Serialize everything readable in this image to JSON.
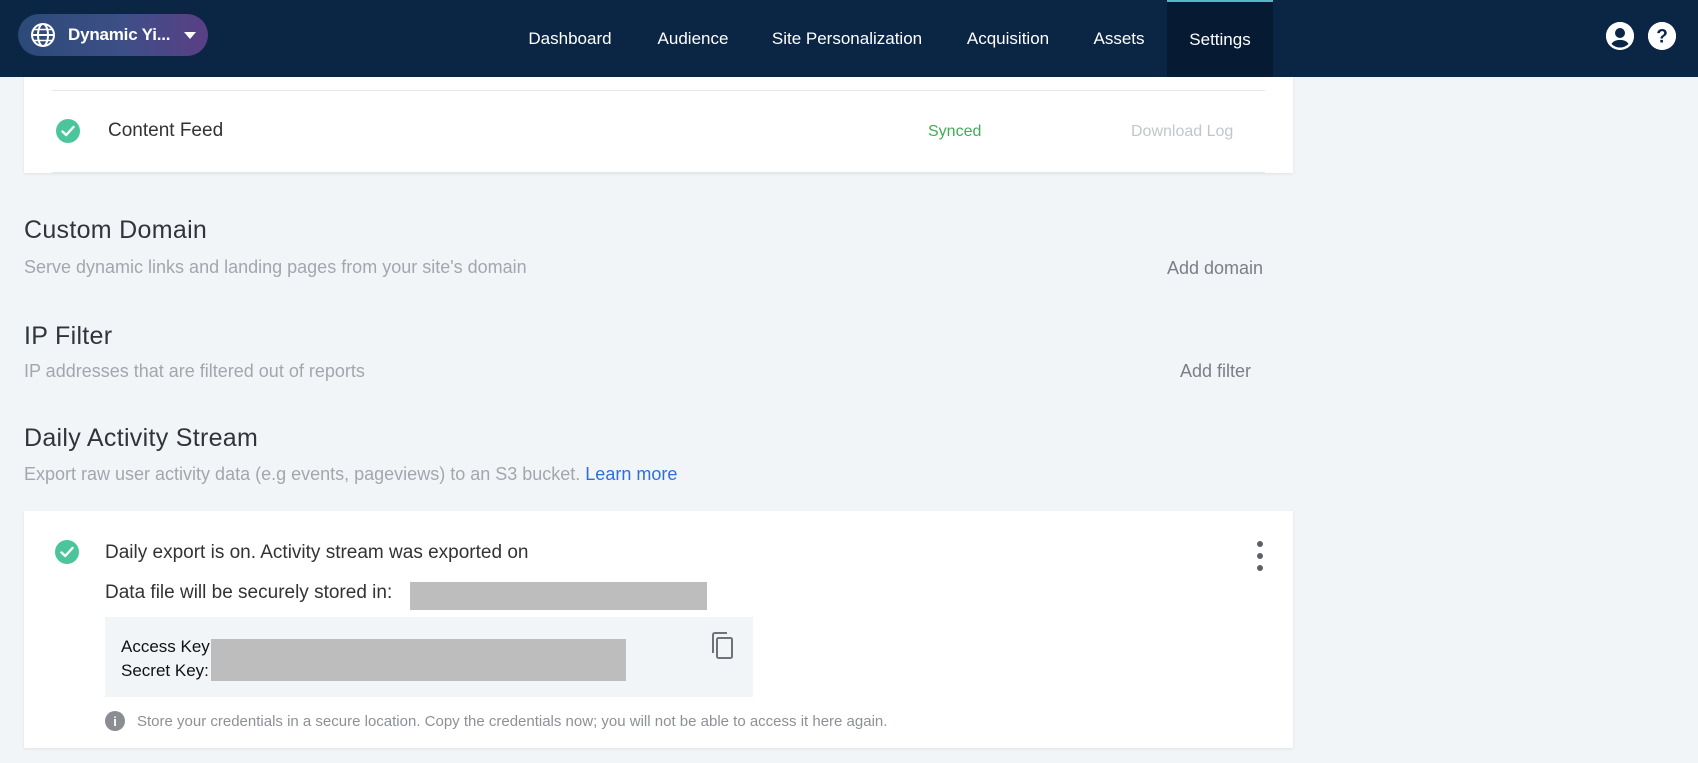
{
  "header": {
    "site_name": "Dynamic Yi...",
    "nav": [
      {
        "label": "Dashboard"
      },
      {
        "label": "Audience"
      },
      {
        "label": "Site Personalization"
      },
      {
        "label": "Acquisition"
      },
      {
        "label": "Assets"
      },
      {
        "label": "Settings",
        "active": true
      }
    ]
  },
  "feeds": {
    "item": {
      "name": "Content Feed",
      "status": "Synced",
      "action": "Download Log"
    }
  },
  "custom_domain": {
    "title": "Custom Domain",
    "description": "Serve dynamic links and landing pages from your site's domain",
    "action": "Add domain"
  },
  "ip_filter": {
    "title": "IP Filter",
    "description": "IP addresses that are filtered out of reports",
    "action": "Add filter"
  },
  "activity_stream": {
    "title": "Daily Activity Stream",
    "description": "Export raw user activity data (e.g events, pageviews) to an S3 bucket.",
    "learn_more": "Learn more",
    "status": "Daily export is on. Activity stream was exported on",
    "stored_in": "Data file will be securely stored in:",
    "access_key_label": "Access Key:",
    "secret_key_label": "Secret Key:",
    "notice": "Store your credentials in a secure location. Copy the credentials now; you will not be able to access it here again."
  },
  "colors": {
    "nav_bg": "#0b2545",
    "success": "#4cc59c",
    "synced_text": "#3fae56",
    "link": "#2f6fd6"
  }
}
